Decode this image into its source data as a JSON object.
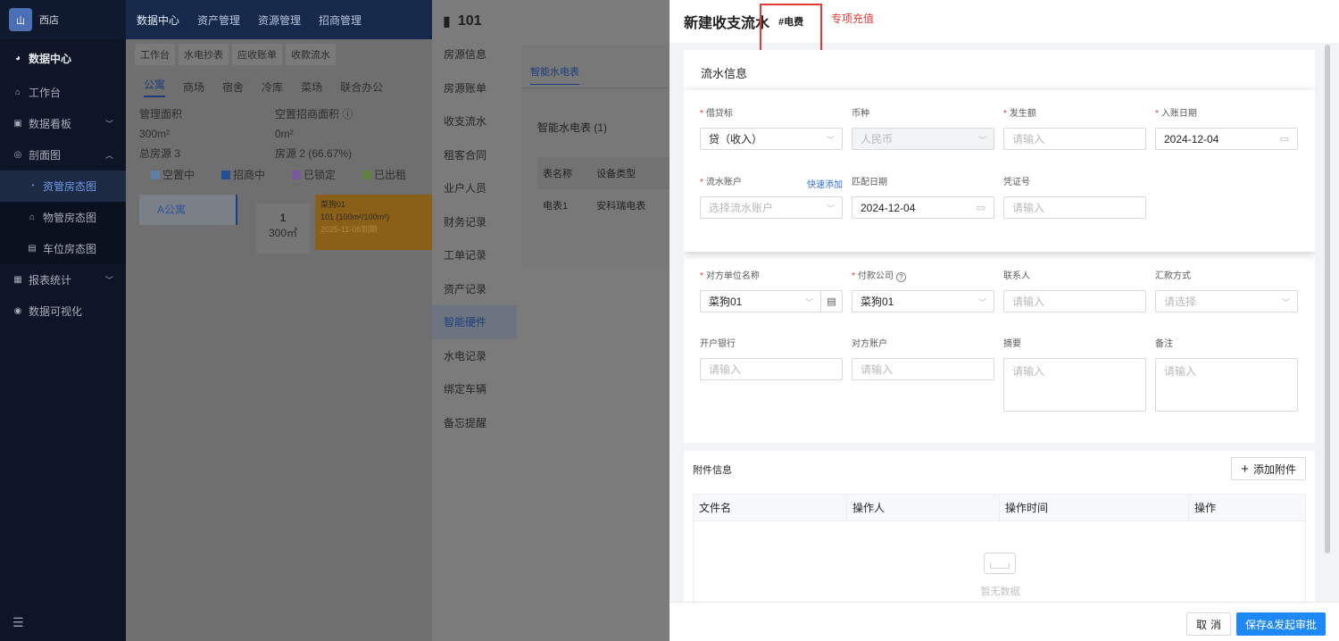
{
  "sidebar": {
    "store_name": "西店",
    "logo_text": "山",
    "head": "数据中心",
    "items": [
      {
        "label": "工作台",
        "icon": "home-icon"
      },
      {
        "label": "数据看板",
        "icon": "dashboard-icon"
      },
      {
        "label": "剖面图",
        "icon": "profile-icon"
      },
      {
        "label": "资管房态图",
        "icon": "asset-room-icon"
      },
      {
        "label": "物管房态图",
        "icon": "property-room-icon"
      },
      {
        "label": "车位房态图",
        "icon": "parking-icon"
      },
      {
        "label": "报表统计",
        "icon": "report-icon"
      },
      {
        "label": "数据可视化",
        "icon": "visual-icon"
      }
    ],
    "collapse_icon": "menu-fold-icon"
  },
  "topnav": [
    "数据中心",
    "资产管理",
    "资源管理",
    "招商管理"
  ],
  "page_tabs": [
    "工作台",
    "水电抄表",
    "应收账单",
    "收款流水"
  ],
  "building_tabs": [
    "公寓",
    "商场",
    "宿舍",
    "冷库",
    "菜场",
    "联合办公"
  ],
  "stats": {
    "mgmt_area_label": "管理面积",
    "vacant_area_label": "空置招商面积",
    "mgmt_area_value": "300m²",
    "vacant_area_value": "0m²",
    "total_rooms": "总房源 3",
    "rooms_pct": "房源 2 (66.67%)"
  },
  "legend": [
    {
      "label": "空置中",
      "color": "#6a8fba"
    },
    {
      "label": "招商中",
      "color": "#2a5aa8"
    },
    {
      "label": "已锁定",
      "color": "#8a63b3"
    },
    {
      "label": "已出租",
      "color": "#6e9a48"
    }
  ],
  "cards": {
    "a_label": "A公寓",
    "unit_num": "1",
    "unit_area": "300㎡",
    "occupant": "菜狗01",
    "occupant_room": "101 (100m²/100m²)",
    "occupant_date": "2025-11-06到期"
  },
  "room": {
    "number": "101",
    "menu": [
      "房源信息",
      "房源账单",
      "收支流水",
      "租客合同",
      "业户人员",
      "财务记录",
      "工单记录",
      "资产记录",
      "智能硬件",
      "水电记录",
      "绑定车辆",
      "备忘提醒"
    ],
    "active_menu": "智能硬件",
    "panel_tab": "智能水电表",
    "panel_section": "智能水电表 (1)",
    "table_headers": [
      "表名称",
      "设备类型"
    ],
    "table_row": [
      "电表1",
      "安科瑞电表"
    ]
  },
  "drawer": {
    "title": "新建收支流水",
    "tag": "#电费",
    "note": "专项充值",
    "section_title": "流水信息",
    "fields": {
      "debit_credit": {
        "label": "借贷标",
        "value": "贷（收入）"
      },
      "currency": {
        "label": "币种",
        "value": "人民币"
      },
      "amount": {
        "label": "发生额",
        "placeholder": "请输入"
      },
      "entry_date": {
        "label": "入账日期",
        "value": "2024-12-04"
      },
      "flow_account": {
        "label": "流水账户",
        "placeholder": "选择流水账户",
        "quick_add": "快速添加"
      },
      "match_date": {
        "label": "匹配日期",
        "value": "2024-12-04"
      },
      "voucher": {
        "label": "凭证号",
        "placeholder": "请输入"
      },
      "counterparty": {
        "label": "对方单位名称",
        "value": "菜狗01"
      },
      "payer": {
        "label": "付款公司",
        "value": "菜狗01"
      },
      "contact": {
        "label": "联系人",
        "placeholder": "请输入"
      },
      "remit_method": {
        "label": "汇款方式",
        "placeholder": "请选择"
      },
      "bank": {
        "label": "开户银行",
        "placeholder": "请输入"
      },
      "counter_account": {
        "label": "对方账户",
        "placeholder": "请输入"
      },
      "summary": {
        "label": "摘要",
        "placeholder": "请输入"
      },
      "remark": {
        "label": "备注",
        "placeholder": "请输入"
      }
    },
    "attachments": {
      "title": "附件信息",
      "add_label": "添加附件",
      "headers": [
        "文件名",
        "操作人",
        "操作时间",
        "操作"
      ],
      "empty_text": "暂无数据"
    },
    "footer": {
      "cancel": "取消",
      "save": "保存&发起审批"
    }
  }
}
